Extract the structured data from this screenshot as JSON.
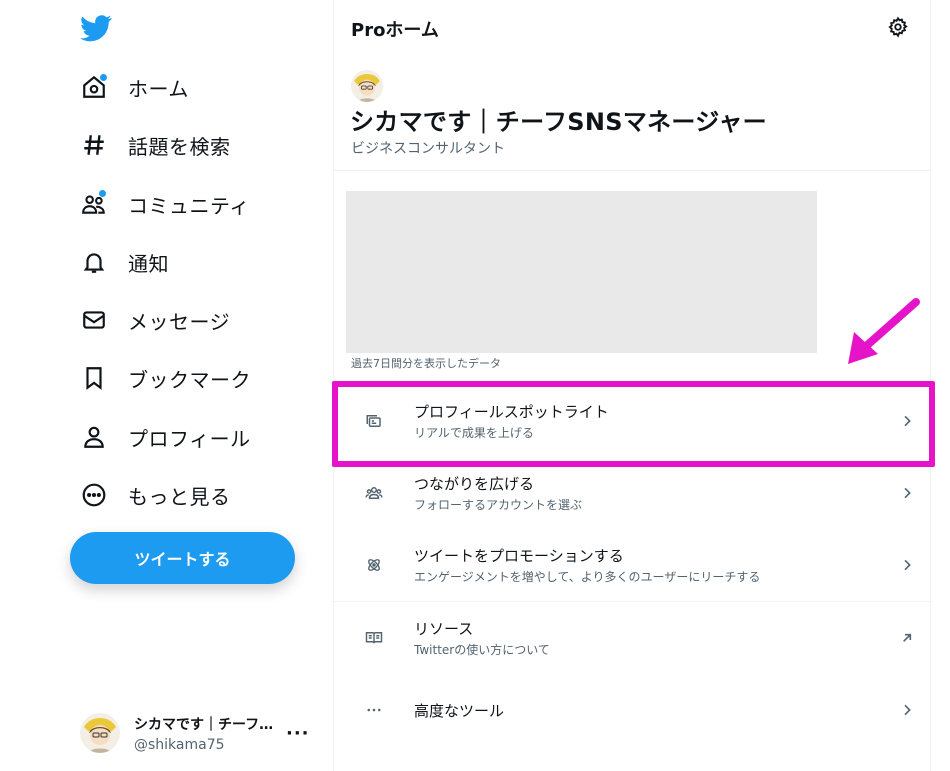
{
  "sidebar": {
    "logo_icon": "twitter-bird-icon",
    "nav": [
      {
        "label": "ホーム",
        "icon": "home-icon",
        "dot": true
      },
      {
        "label": "話題を検索",
        "icon": "hashtag-icon",
        "dot": false
      },
      {
        "label": "コミュニティ",
        "icon": "communities-icon",
        "dot": true
      },
      {
        "label": "通知",
        "icon": "bell-icon",
        "dot": false
      },
      {
        "label": "メッセージ",
        "icon": "envelope-icon",
        "dot": false
      },
      {
        "label": "ブックマーク",
        "icon": "bookmark-icon",
        "dot": false
      },
      {
        "label": "プロフィール",
        "icon": "person-icon",
        "dot": false
      },
      {
        "label": "もっと見る",
        "icon": "more-circle-icon",
        "dot": false
      }
    ],
    "tweet_button": "ツイートする",
    "account": {
      "name": "シカマです｜チーフSNSマネージャー",
      "handle": "@shikama75",
      "more": "···"
    }
  },
  "main": {
    "title": "Proホーム",
    "profile": {
      "name": "シカマです｜チーフSNSマネージャー",
      "role": "ビジネスコンサルタント"
    },
    "caption": "過去7日間分を表示したデータ",
    "rows": [
      {
        "title": "プロフィールスポットライト",
        "sub": "リアルで成果を上げる",
        "icon": "spotlight-card-icon",
        "chevron": "chevron-right-icon",
        "highlighted": true
      },
      {
        "title": "つながりを広げる",
        "sub": "フォローするアカウントを選ぶ",
        "icon": "people-group-icon",
        "chevron": "chevron-right-icon",
        "highlighted": false
      },
      {
        "title": "ツイートをプロモーションする",
        "sub": "エンゲージメントを増やして、より多くのユーザーにリーチする",
        "icon": "promote-atom-icon",
        "chevron": "chevron-right-icon",
        "highlighted": false
      },
      {
        "title": "リソース",
        "sub": "Twitterの使い方について",
        "icon": "open-book-icon",
        "chevron": "external-arrow-icon",
        "highlighted": false
      },
      {
        "title": "高度なツール",
        "sub": "",
        "icon": "ellipsis-icon",
        "chevron": "chevron-right-icon",
        "highlighted": false
      }
    ]
  },
  "colors": {
    "accent": "#1d9bf0",
    "highlight": "#e614c8",
    "text": "#0f1419",
    "secondary": "#536471"
  }
}
